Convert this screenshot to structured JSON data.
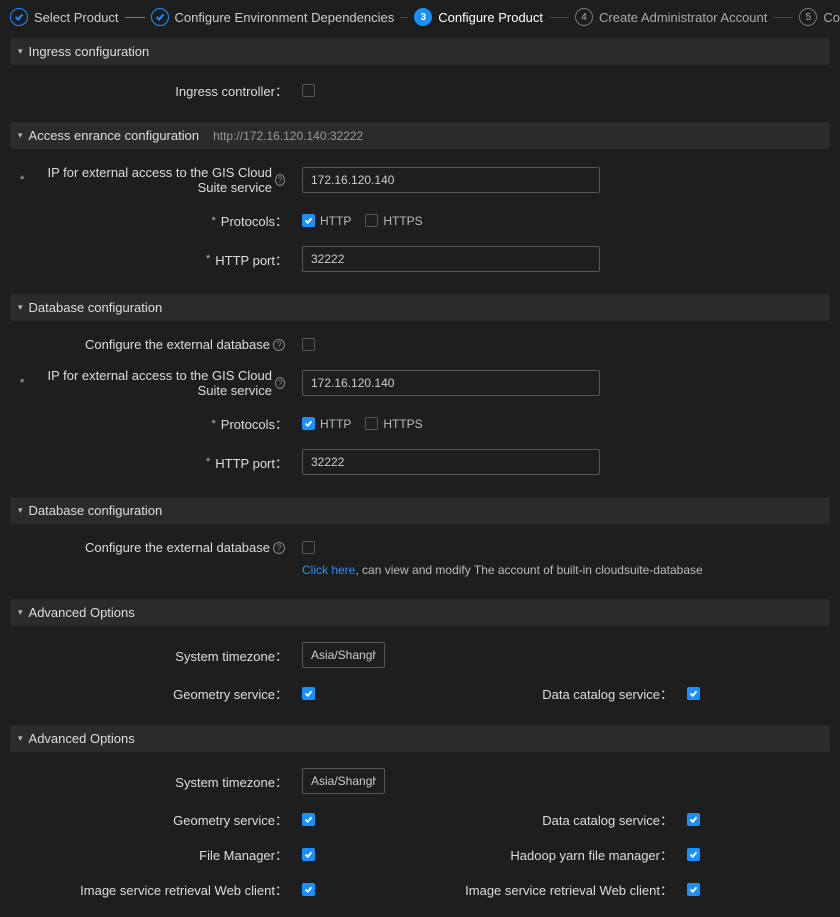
{
  "stepper": {
    "steps": [
      {
        "label": "Select Product",
        "state": "done"
      },
      {
        "label": "Configure Environment Dependencies",
        "state": "done"
      },
      {
        "label": "Configure Product",
        "state": "active",
        "num": "3"
      },
      {
        "label": "Create Administrator Account",
        "state": "pending",
        "num": "4"
      },
      {
        "label": "Confirm Deployment",
        "state": "pending",
        "num": "5"
      }
    ]
  },
  "sections": {
    "ingress": {
      "title": "Ingress configuration",
      "controller_label": "Ingress controller："
    },
    "access": {
      "title": "Access enrance configuration",
      "extra": "http://172.16.120.140:32222",
      "ip_label": "IP for external access to the GIS Cloud Suite service",
      "ip_value": "172.16.120.140",
      "proto_label": "Protocols：",
      "http": "HTTP",
      "https": "HTTPS",
      "port_label": "HTTP port：",
      "port_value": "32222"
    },
    "db1": {
      "title": "Database configuration",
      "ext_label": "Configure the external database",
      "ip_label": "IP for external access to the GIS Cloud Suite service",
      "ip_value": "172.16.120.140",
      "proto_label": "Protocols：",
      "http": "HTTP",
      "https": "HTTPS",
      "port_label": "HTTP port：",
      "port_value": "32222"
    },
    "db2": {
      "title": "Database configuration",
      "ext_label": "Configure the external database",
      "hint_link": "Click here",
      "hint_rest": ", can view and modify The account of built-in cloudsuite-database"
    },
    "adv1": {
      "title": "Advanced Options",
      "tz_label": "System timezone：",
      "tz_value": "Asia/Shanghai",
      "geom_label": "Geometry service：",
      "catalog_label": "Data catalog service："
    },
    "adv2": {
      "title": "Advanced Options",
      "tz_label": "System timezone：",
      "tz_value": "Asia/Shanghai",
      "geom_label": "Geometry service：",
      "catalog_label": "Data catalog service：",
      "file_label": "File Manager：",
      "hadoop_label": "Hadoop yarn file manager：",
      "img_client_label": "Image service retrieval Web client：",
      "img_client_label2": "Image service retrieval Web client："
    }
  },
  "colon_suffix": "："
}
